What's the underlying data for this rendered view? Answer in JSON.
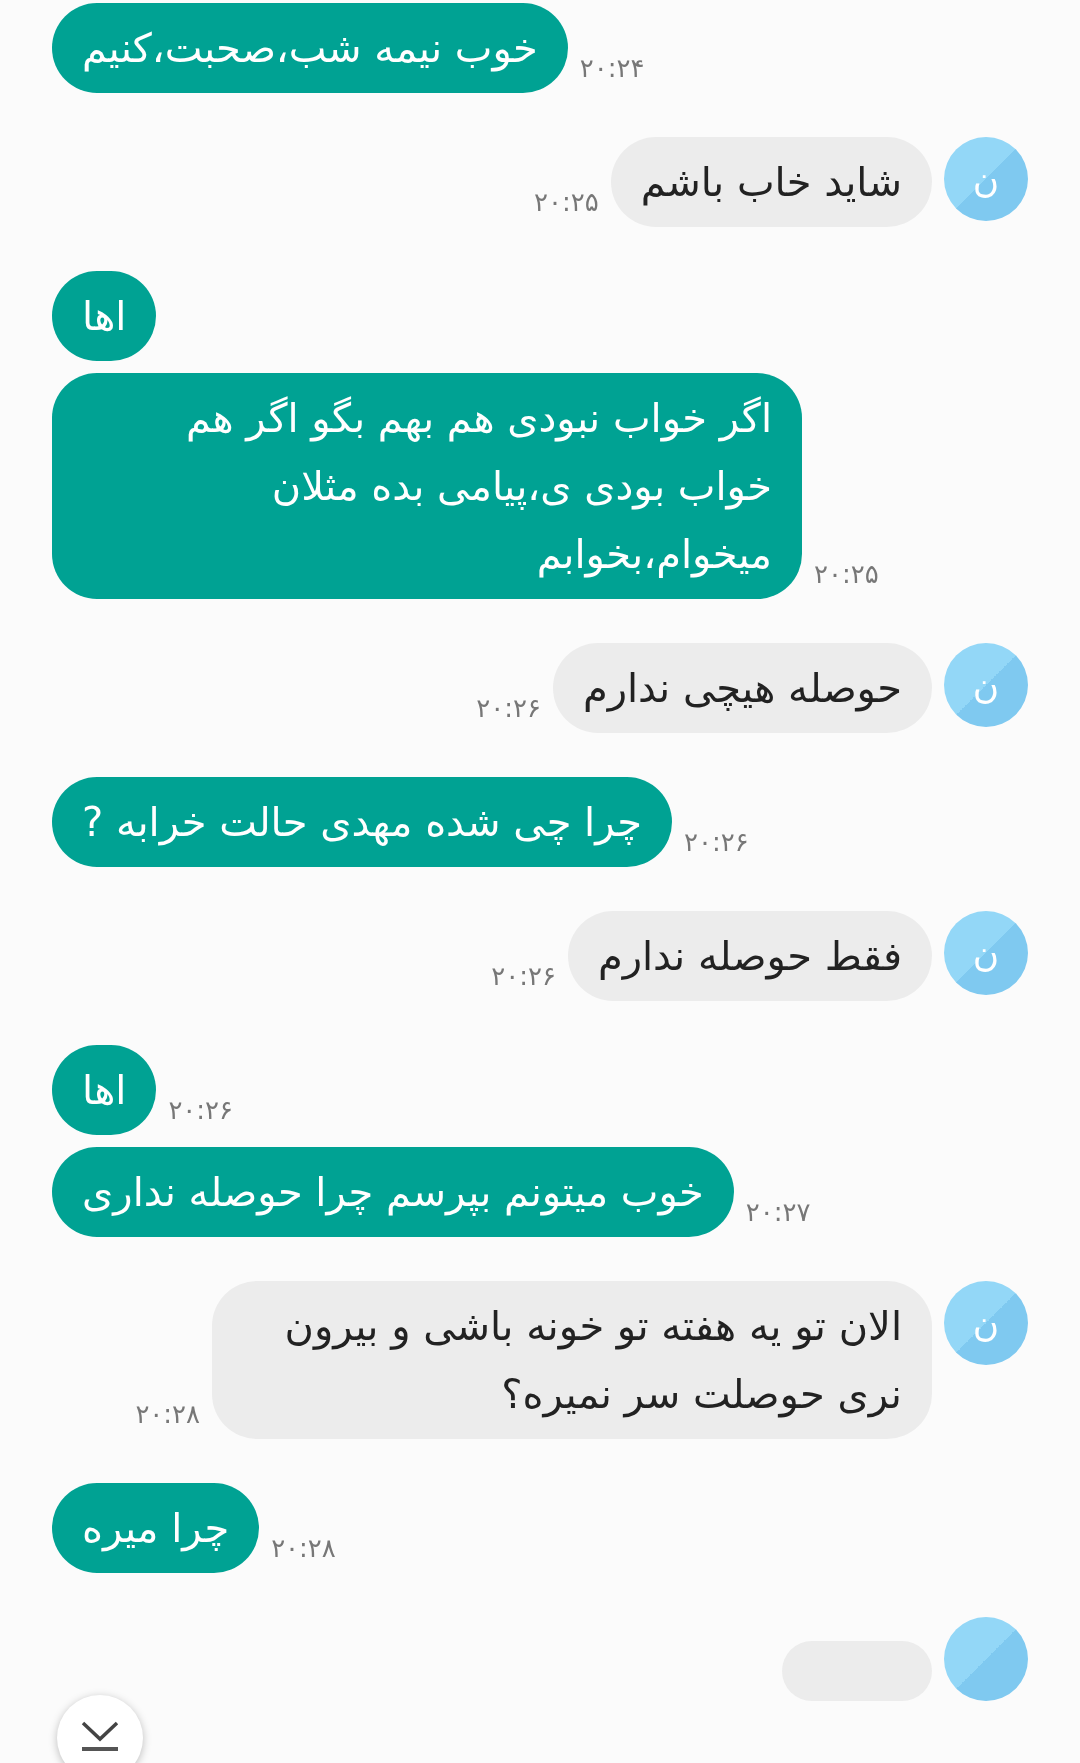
{
  "messages": [
    {
      "kind": "outgoing",
      "text": "خوب نیمه شب،صحبت،کنیم",
      "time": "۲۰:۲۴"
    },
    {
      "kind": "incoming",
      "avatar": "ن",
      "text": "شاید خاب باشم",
      "time": "۲۰:۲۵"
    },
    {
      "kind": "outgoing",
      "text": "اها"
    },
    {
      "kind": "outgoing",
      "text": "اگر خواب نبودی هم بهم بگو اگر هم خواب بودی ی،پیامی بده مثلان میخوام،بخوابم",
      "time": "۲۰:۲۵"
    },
    {
      "kind": "incoming",
      "avatar": "ن",
      "text": "حوصله هیچی ندارم",
      "time": "۲۰:۲۶"
    },
    {
      "kind": "outgoing",
      "text": "چرا چی شده مهدی حالت خرابه ?",
      "time": "۲۰:۲۶"
    },
    {
      "kind": "incoming",
      "avatar": "ن",
      "text": "فقط حوصله ندارم",
      "time": "۲۰:۲۶"
    },
    {
      "kind": "outgoing",
      "text": "اها",
      "time": "۲۰:۲۶"
    },
    {
      "kind": "outgoing",
      "text": "خوب میتونم بپرسم چرا حوصله ندارى",
      "time": "۲۰:۲۷"
    },
    {
      "kind": "incoming",
      "avatar": "ن",
      "text": "الان تو یه هفته تو خونه باشی و بیرون نری حوصلت سر نمیره؟",
      "time": "۲۰:۲۸"
    },
    {
      "kind": "outgoing",
      "text": "چرا میره",
      "time": "۲۰:۲۸"
    },
    {
      "kind": "incoming_cut"
    }
  ]
}
